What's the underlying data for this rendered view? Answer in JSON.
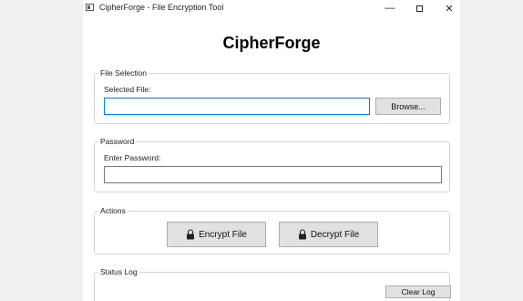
{
  "window": {
    "title": "CipherForge - File Encryption Tool",
    "controls": {
      "minimize": "—",
      "close": "✕"
    }
  },
  "header": {
    "title": "CipherForge"
  },
  "file_selection": {
    "legend": "File Selection",
    "label": "Selected File:",
    "value": "",
    "browse_label": "Browse..."
  },
  "password": {
    "legend": "Password",
    "label": "Enter Password:",
    "value": ""
  },
  "actions": {
    "legend": "Actions",
    "encrypt_label": "Encrypt File",
    "decrypt_label": "Decrypt File",
    "icon": "lock-icon"
  },
  "status_log": {
    "legend": "Status Log",
    "clear_label": "Clear Log"
  }
}
